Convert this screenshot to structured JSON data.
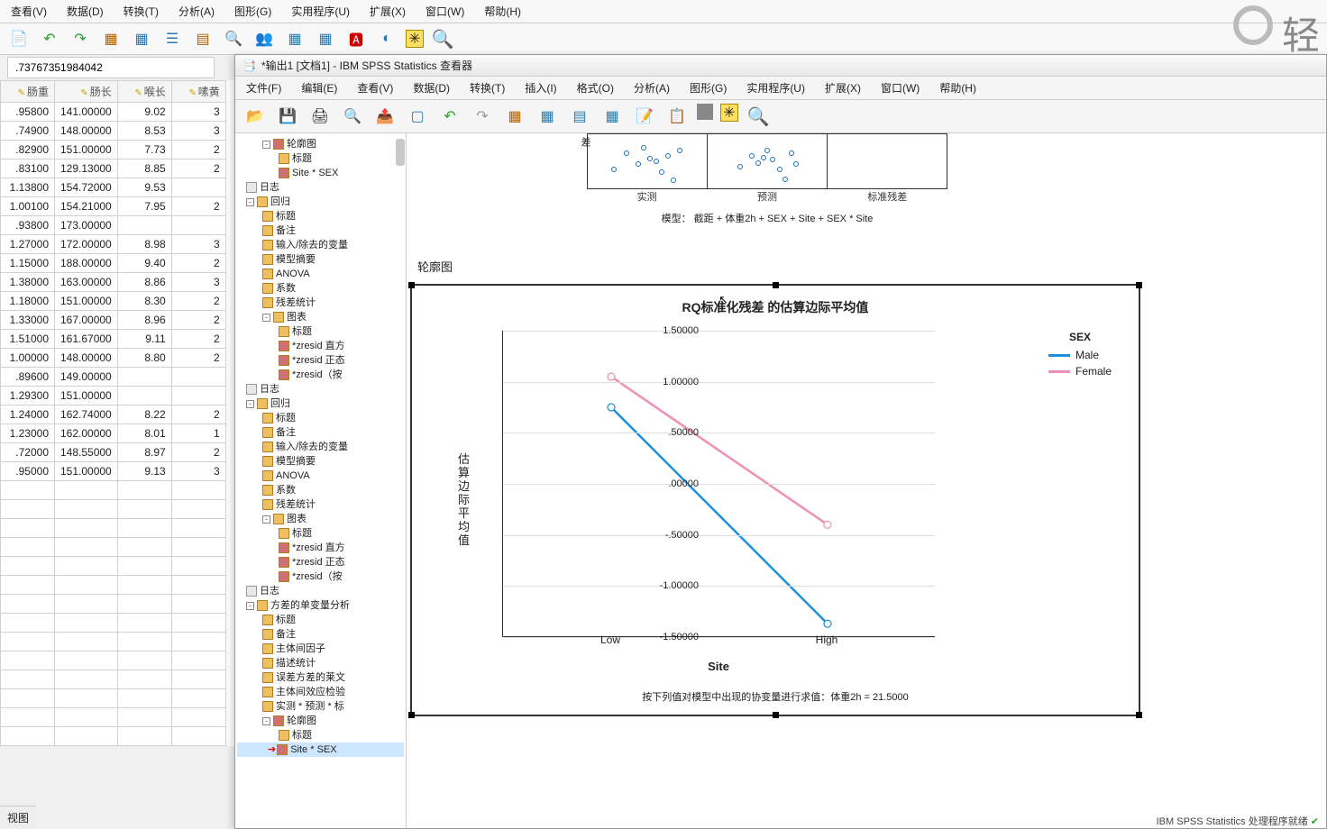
{
  "back_window": {
    "menus": [
      "查看(V)",
      "数据(D)",
      "转换(T)",
      "分析(A)",
      "图形(G)",
      "实用程序(U)",
      "扩展(X)",
      "窗口(W)",
      "帮助(H)"
    ],
    "cell_value": ".73767351984042",
    "columns": [
      "肠重",
      "肠长",
      "喉长",
      "嗉黄"
    ],
    "rows": [
      [
        ".95800",
        "141.00000",
        "9.02",
        "3"
      ],
      [
        ".74900",
        "148.00000",
        "8.53",
        "3"
      ],
      [
        ".82900",
        "151.00000",
        "7.73",
        "2"
      ],
      [
        ".83100",
        "129.13000",
        "8.85",
        "2"
      ],
      [
        "1.13800",
        "154.72000",
        "9.53",
        ""
      ],
      [
        "1.00100",
        "154.21000",
        "7.95",
        "2"
      ],
      [
        ".93800",
        "173.00000",
        "",
        ""
      ],
      [
        "1.27000",
        "172.00000",
        "8.98",
        "3"
      ],
      [
        "1.15000",
        "188.00000",
        "9.40",
        "2"
      ],
      [
        "1.38000",
        "163.00000",
        "8.86",
        "3"
      ],
      [
        "1.18000",
        "151.00000",
        "8.30",
        "2"
      ],
      [
        "1.33000",
        "167.00000",
        "8.96",
        "2"
      ],
      [
        "1.51000",
        "161.67000",
        "9.11",
        "2"
      ],
      [
        "1.00000",
        "148.00000",
        "8.80",
        "2"
      ],
      [
        ".89600",
        "149.00000",
        "",
        ""
      ],
      [
        "1.29300",
        "151.00000",
        "",
        ""
      ],
      [
        "1.24000",
        "162.74000",
        "8.22",
        "2"
      ],
      [
        "1.23000",
        "162.00000",
        "8.01",
        "1"
      ],
      [
        ".72000",
        "148.55000",
        "8.97",
        "2"
      ],
      [
        ".95000",
        "151.00000",
        "9.13",
        "3"
      ]
    ],
    "tab_label": "视图"
  },
  "viewer": {
    "title": "*输出1 [文档1] - IBM SPSS Statistics 查看器",
    "menus": [
      "文件(F)",
      "编辑(E)",
      "查看(V)",
      "数据(D)",
      "转换(T)",
      "插入(I)",
      "格式(O)",
      "分析(A)",
      "图形(G)",
      "实用程序(U)",
      "扩展(X)",
      "窗口(W)",
      "帮助(H)"
    ],
    "outline": [
      {
        "lev": 2,
        "twist": "-",
        "icon": "chart",
        "label": "轮廓图"
      },
      {
        "lev": 3,
        "icon": "table",
        "label": "标题"
      },
      {
        "lev": 3,
        "icon": "chart",
        "label": "Site * SEX"
      },
      {
        "lev": 1,
        "icon": "log",
        "label": "日志"
      },
      {
        "lev": 1,
        "twist": "-",
        "icon": "table",
        "label": "回归"
      },
      {
        "lev": 2,
        "icon": "table",
        "label": "标题"
      },
      {
        "lev": 2,
        "icon": "table",
        "label": "备注"
      },
      {
        "lev": 2,
        "icon": "table",
        "label": "输入/除去的变量"
      },
      {
        "lev": 2,
        "icon": "table",
        "label": "模型摘要"
      },
      {
        "lev": 2,
        "icon": "table",
        "label": "ANOVA"
      },
      {
        "lev": 2,
        "icon": "table",
        "label": "系数"
      },
      {
        "lev": 2,
        "icon": "table",
        "label": "残差统计"
      },
      {
        "lev": 2,
        "twist": "-",
        "icon": "table",
        "label": "图表"
      },
      {
        "lev": 3,
        "icon": "table",
        "label": "标题"
      },
      {
        "lev": 3,
        "icon": "chart",
        "label": "*zresid 直方"
      },
      {
        "lev": 3,
        "icon": "chart",
        "label": "*zresid 正态"
      },
      {
        "lev": 3,
        "icon": "chart",
        "label": "*zresid（按"
      },
      {
        "lev": 1,
        "icon": "log",
        "label": "日志"
      },
      {
        "lev": 1,
        "twist": "-",
        "icon": "table",
        "label": "回归"
      },
      {
        "lev": 2,
        "icon": "table",
        "label": "标题"
      },
      {
        "lev": 2,
        "icon": "table",
        "label": "备注"
      },
      {
        "lev": 2,
        "icon": "table",
        "label": "输入/除去的变量"
      },
      {
        "lev": 2,
        "icon": "table",
        "label": "模型摘要"
      },
      {
        "lev": 2,
        "icon": "table",
        "label": "ANOVA"
      },
      {
        "lev": 2,
        "icon": "table",
        "label": "系数"
      },
      {
        "lev": 2,
        "icon": "table",
        "label": "残差统计"
      },
      {
        "lev": 2,
        "twist": "-",
        "icon": "table",
        "label": "图表"
      },
      {
        "lev": 3,
        "icon": "table",
        "label": "标题"
      },
      {
        "lev": 3,
        "icon": "chart",
        "label": "*zresid 直方"
      },
      {
        "lev": 3,
        "icon": "chart",
        "label": "*zresid 正态"
      },
      {
        "lev": 3,
        "icon": "chart",
        "label": "*zresid（按"
      },
      {
        "lev": 1,
        "icon": "log",
        "label": "日志"
      },
      {
        "lev": 1,
        "twist": "-",
        "icon": "table",
        "label": "方差的单变量分析"
      },
      {
        "lev": 2,
        "icon": "table",
        "label": "标题"
      },
      {
        "lev": 2,
        "icon": "table",
        "label": "备注"
      },
      {
        "lev": 2,
        "icon": "table",
        "label": "主体间因子"
      },
      {
        "lev": 2,
        "icon": "table",
        "label": "描述统计"
      },
      {
        "lev": 2,
        "icon": "table",
        "label": "误差方差的莱文"
      },
      {
        "lev": 2,
        "icon": "table",
        "label": "主体间效应检验"
      },
      {
        "lev": 2,
        "icon": "table",
        "label": "实测 * 预测 * 标"
      },
      {
        "lev": 2,
        "twist": "-",
        "icon": "chart",
        "label": "轮廓图"
      },
      {
        "lev": 3,
        "icon": "table",
        "label": "标题"
      },
      {
        "lev": 3,
        "icon": "chart",
        "label": "Site * SEX",
        "sel": true,
        "current": true
      }
    ],
    "scatter": {
      "axis_label": "差",
      "col_labels": [
        "实测",
        "预测",
        "标准残差"
      ],
      "model_caption": "模型：  截距 + 体重2h + SEX + Site + SEX * Site"
    },
    "section_title": "轮廓图",
    "footnote": "按下列值对模型中出现的协变量进行求值：体重2h = 21.5000",
    "status": "IBM SPSS Statistics 处理程序就绪"
  },
  "chart_data": {
    "type": "line",
    "title": "RQ标准化残差 的估算边际平均值",
    "xlabel": "Site",
    "ylabel": "估算边际平均值",
    "categories": [
      "Low",
      "High"
    ],
    "series": [
      {
        "name": "Male",
        "color": "#1e90d8",
        "values": [
          0.75,
          -1.37
        ]
      },
      {
        "name": "Female",
        "color": "#ef8fb5",
        "values": [
          1.05,
          -0.4
        ]
      }
    ],
    "ylim": [
      -1.5,
      1.5
    ],
    "yticks": [
      "1.50000",
      "1.00000",
      ".50000",
      ".00000",
      "-.50000",
      "-1.00000",
      "-1.50000"
    ],
    "legend_title": "SEX"
  }
}
